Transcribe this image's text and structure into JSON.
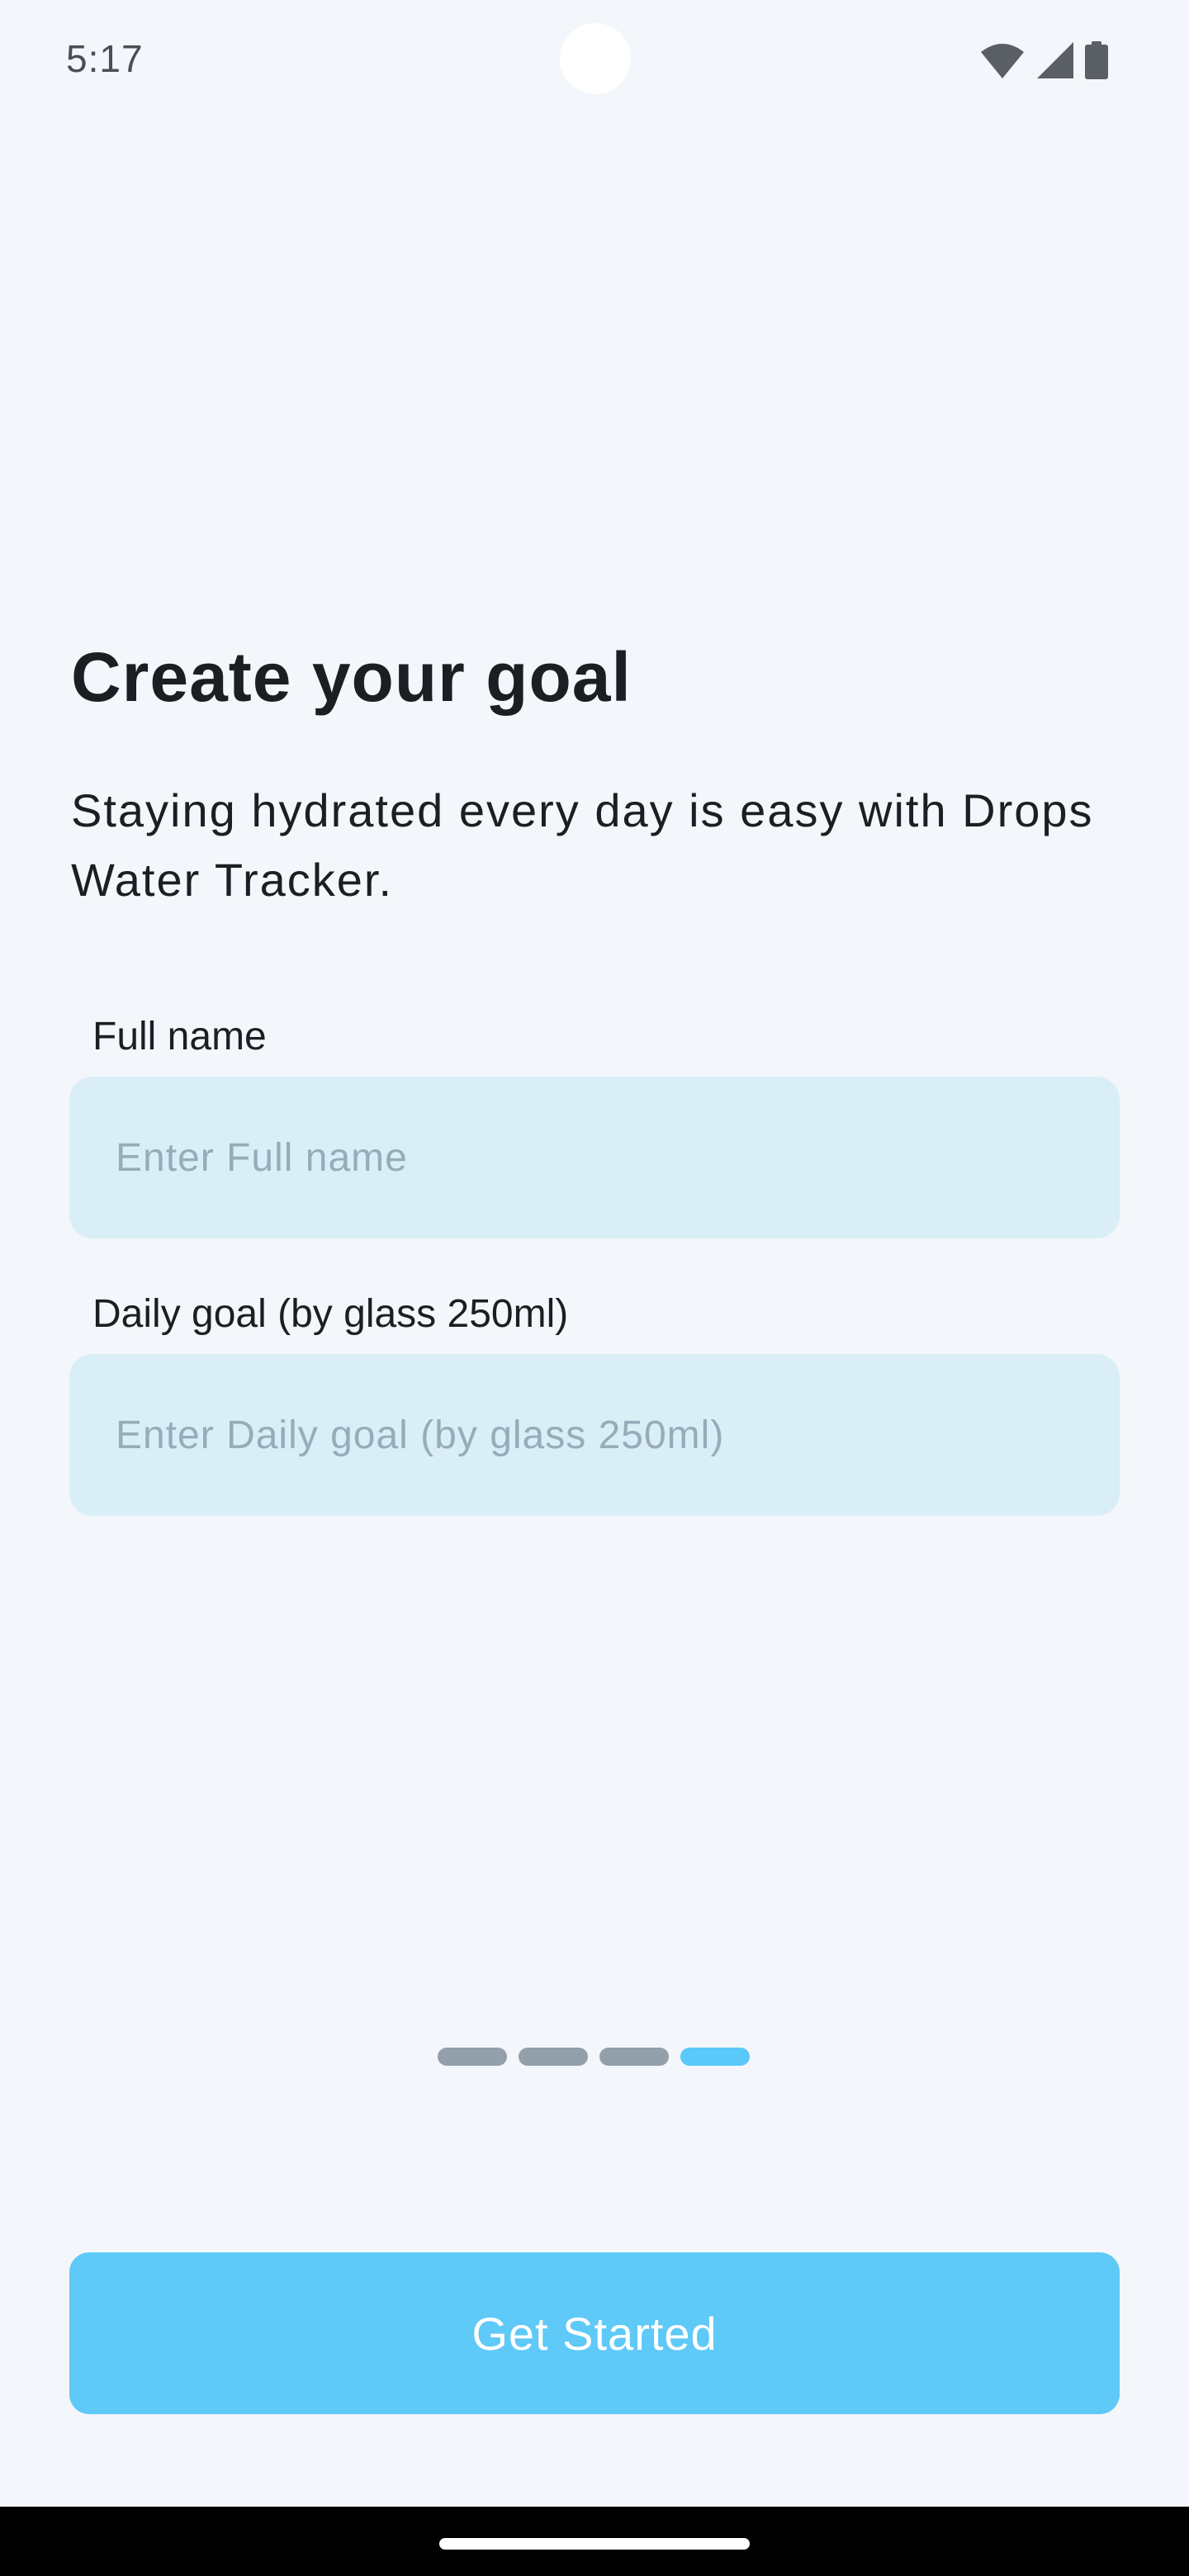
{
  "status_bar": {
    "time": "5:17",
    "icons": [
      "wifi-icon",
      "cellular-signal-icon",
      "battery-icon"
    ]
  },
  "onboarding": {
    "title": "Create your goal",
    "subtitle": "Staying hydrated every day is easy with Drops Water Tracker."
  },
  "form": {
    "full_name": {
      "label": "Full name",
      "placeholder": "Enter Full name",
      "value": ""
    },
    "daily_goal": {
      "label": "Daily goal (by glass 250ml)",
      "placeholder": "Enter Daily goal (by glass 250ml)",
      "value": ""
    }
  },
  "pager": {
    "total_pages": 4,
    "current_page": 4
  },
  "cta": {
    "label": "Get Started"
  },
  "colors": {
    "background": "#F3F6FA",
    "input_background": "#D9EEF6",
    "placeholder": "#97ABBA",
    "accent": "#5FC9F8",
    "pager_inactive": "#939FA9",
    "text_primary": "#1B1F23"
  }
}
